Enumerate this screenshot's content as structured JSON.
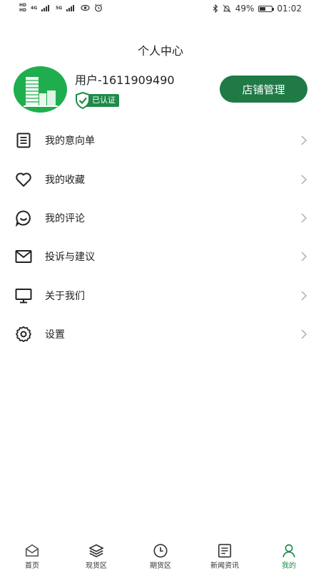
{
  "status_bar": {
    "net_labels": [
      "HD",
      "HD"
    ],
    "net1": "4G",
    "net2": "5G",
    "battery": "49%",
    "battery_level": 0.49,
    "time": "01:02"
  },
  "page_title": "个人中心",
  "profile": {
    "username": "用户-1611909490",
    "verified_label": "已认证",
    "store_button": "店铺管理"
  },
  "menu": {
    "items": [
      {
        "label": "我的意向单",
        "icon": "document-list-icon"
      },
      {
        "label": "我的收藏",
        "icon": "heart-icon"
      },
      {
        "label": "我的评论",
        "icon": "comment-smile-icon"
      },
      {
        "label": "投诉与建议",
        "icon": "envelope-icon"
      },
      {
        "label": "关于我们",
        "icon": "monitor-icon"
      },
      {
        "label": "设置",
        "icon": "gear-icon"
      }
    ]
  },
  "bottom_nav": {
    "items": [
      {
        "label": "首页",
        "icon": "home-icon"
      },
      {
        "label": "现货区",
        "icon": "layers-icon"
      },
      {
        "label": "期货区",
        "icon": "clock-icon"
      },
      {
        "label": "新闻资讯",
        "icon": "news-icon"
      },
      {
        "label": "我的",
        "icon": "person-icon"
      }
    ],
    "active_index": 4
  },
  "colors": {
    "accent": "#1f7a46",
    "badge": "#1f8a49",
    "avatar": "#1fae4e"
  }
}
